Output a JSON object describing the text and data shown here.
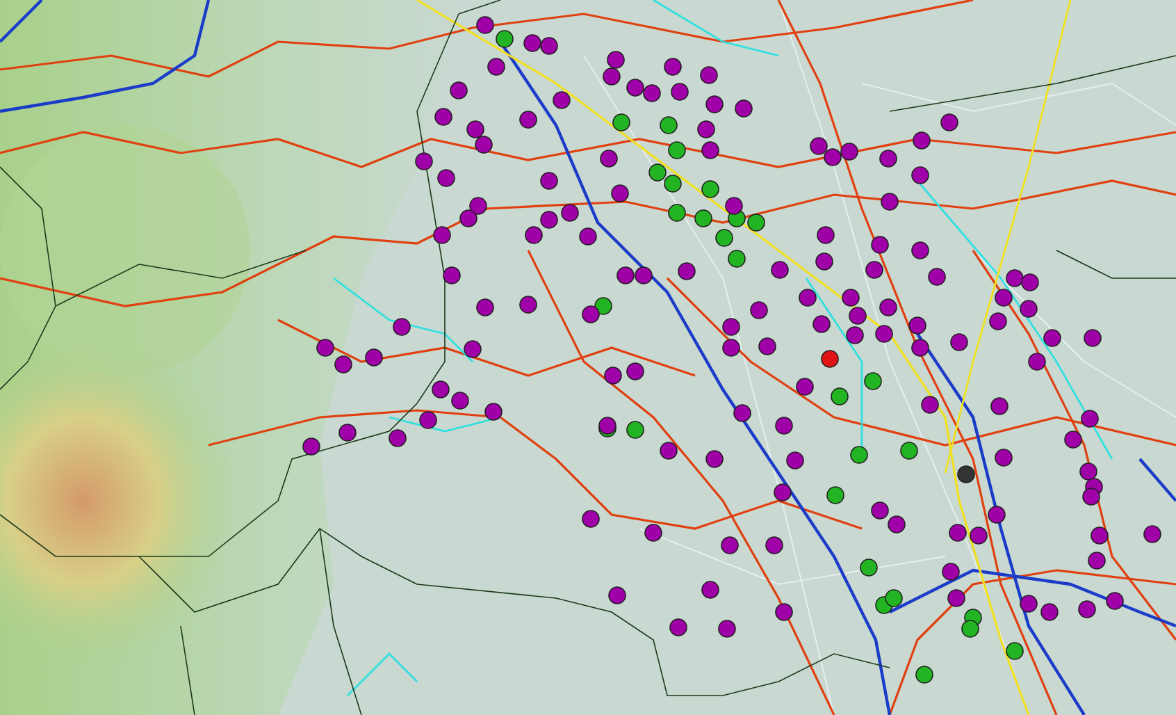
{
  "map": {
    "markers": [
      {
        "color": "#22b422"
      },
      {
        "color": "#22b422"
      },
      {
        "color": "#22b422"
      },
      {
        "color": "#22b422"
      },
      {
        "color": "#22b422"
      },
      {
        "color": "#22b422"
      },
      {
        "color": "#22b422"
      },
      {
        "color": "#22b422"
      },
      {
        "color": "#22b422"
      },
      {
        "color": "#22b422"
      },
      {
        "color": "#22b422"
      },
      {
        "color": "#22b422"
      },
      {
        "color": "#22b422"
      },
      {
        "color": "#22b422"
      },
      {
        "color": "#22b422"
      },
      {
        "color": "#22b422"
      },
      {
        "color": "#22b422"
      },
      {
        "color": "#22b422"
      },
      {
        "color": "#22b422"
      },
      {
        "color": "#22b422"
      },
      {
        "color": "#22b422"
      },
      {
        "color": "#22b422"
      },
      {
        "color": "#22b422"
      },
      {
        "color": "#22b422"
      },
      {
        "color": "#22b422"
      },
      {
        "color": "#22b422"
      },
      {
        "color": "#22b422"
      },
      {
        "color": "#22b422"
      },
      {
        "color": "#e01414"
      },
      {
        "color": "#333333"
      },
      {
        "color": "#a000a8"
      },
      {
        "color": "#a000a8"
      },
      {
        "color": "#a000a8"
      },
      {
        "color": "#a000a8"
      },
      {
        "color": "#a000a8"
      },
      {
        "color": "#a000a8"
      },
      {
        "color": "#a000a8"
      },
      {
        "color": "#a000a8"
      },
      {
        "color": "#a000a8"
      },
      {
        "color": "#a000a8"
      },
      {
        "color": "#a000a8"
      },
      {
        "color": "#a000a8"
      },
      {
        "color": "#a000a8"
      },
      {
        "color": "#a000a8"
      },
      {
        "color": "#a000a8"
      },
      {
        "color": "#a000a8"
      },
      {
        "color": "#a000a8"
      },
      {
        "color": "#a000a8"
      },
      {
        "color": "#a000a8"
      },
      {
        "color": "#a000a8"
      },
      {
        "color": "#a000a8"
      },
      {
        "color": "#a000a8"
      },
      {
        "color": "#a000a8"
      },
      {
        "color": "#a000a8"
      },
      {
        "color": "#a000a8"
      },
      {
        "color": "#a000a8"
      },
      {
        "color": "#a000a8"
      },
      {
        "color": "#a000a8"
      },
      {
        "color": "#a000a8"
      },
      {
        "color": "#a000a8"
      },
      {
        "color": "#a000a8"
      },
      {
        "color": "#a000a8"
      },
      {
        "color": "#a000a8"
      },
      {
        "color": "#a000a8"
      },
      {
        "color": "#a000a8"
      },
      {
        "color": "#a000a8"
      },
      {
        "color": "#a000a8"
      },
      {
        "color": "#a000a8"
      },
      {
        "color": "#a000a8"
      },
      {
        "color": "#a000a8"
      },
      {
        "color": "#a000a8"
      },
      {
        "color": "#a000a8"
      },
      {
        "color": "#a000a8"
      },
      {
        "color": "#a000a8"
      },
      {
        "color": "#a000a8"
      },
      {
        "color": "#a000a8"
      },
      {
        "color": "#a000a8"
      },
      {
        "color": "#a000a8"
      },
      {
        "color": "#a000a8"
      },
      {
        "color": "#a000a8"
      },
      {
        "color": "#a000a8"
      },
      {
        "color": "#a000a8"
      },
      {
        "color": "#a000a8"
      },
      {
        "color": "#a000a8"
      },
      {
        "color": "#a000a8"
      },
      {
        "color": "#a000a8"
      },
      {
        "color": "#a000a8"
      },
      {
        "color": "#a000a8"
      },
      {
        "color": "#a000a8"
      },
      {
        "color": "#a000a8"
      },
      {
        "color": "#a000a8"
      },
      {
        "color": "#a000a8"
      },
      {
        "color": "#a000a8"
      },
      {
        "color": "#a000a8"
      },
      {
        "color": "#a000a8"
      },
      {
        "color": "#a000a8"
      },
      {
        "color": "#a000a8"
      },
      {
        "color": "#a000a8"
      },
      {
        "color": "#a000a8"
      },
      {
        "color": "#a000a8"
      },
      {
        "color": "#a000a8"
      },
      {
        "color": "#a000a8"
      },
      {
        "color": "#a000a8"
      },
      {
        "color": "#a000a8"
      },
      {
        "color": "#a000a8"
      },
      {
        "color": "#a000a8"
      },
      {
        "color": "#a000a8"
      },
      {
        "color": "#a000a8"
      },
      {
        "color": "#a000a8"
      },
      {
        "color": "#a000a8"
      },
      {
        "color": "#a000a8"
      },
      {
        "color": "#a000a8"
      },
      {
        "color": "#a000a8"
      },
      {
        "color": "#a000a8"
      },
      {
        "color": "#a000a8"
      },
      {
        "color": "#a000a8"
      },
      {
        "color": "#a000a8"
      },
      {
        "color": "#a000a8"
      },
      {
        "color": "#a000a8"
      },
      {
        "color": "#a000a8"
      },
      {
        "color": "#a000a8"
      },
      {
        "color": "#a000a8"
      },
      {
        "color": "#a000a8"
      },
      {
        "color": "#a000a8"
      },
      {
        "color": "#a000a8"
      },
      {
        "color": "#a000a8"
      },
      {
        "color": "#a000a8"
      },
      {
        "color": "#a000a8"
      },
      {
        "color": "#a000a8"
      },
      {
        "color": "#a000a8"
      },
      {
        "color": "#a000a8"
      },
      {
        "color": "#a000a8"
      },
      {
        "color": "#a000a8"
      },
      {
        "color": "#a000a8"
      },
      {
        "color": "#a000a8"
      },
      {
        "color": "#a000a8"
      },
      {
        "color": "#a000a8"
      },
      {
        "color": "#a000a8"
      },
      {
        "color": "#a000a8"
      },
      {
        "color": "#a000a8"
      },
      {
        "color": "#a000a8"
      },
      {
        "color": "#a000a8"
      },
      {
        "color": "#a000a8"
      },
      {
        "color": "#a000a8"
      },
      {
        "color": "#a000a8"
      },
      {
        "color": "#a000a8"
      },
      {
        "color": "#a000a8"
      },
      {
        "color": "#a000a8"
      },
      {
        "color": "#a000a8"
      },
      {
        "color": "#a000a8"
      },
      {
        "color": "#a000a8"
      },
      {
        "color": "#a000a8"
      },
      {
        "color": "#a000a8"
      },
      {
        "color": "#a000a8"
      },
      {
        "color": "#a000a8"
      },
      {
        "color": "#a000a8"
      },
      {
        "color": "#a000a8"
      },
      {
        "color": "#a000a8"
      },
      {
        "color": "#a000a8"
      },
      {
        "color": "#a000a8"
      },
      {
        "color": "#a000a8"
      }
    ]
  }
}
